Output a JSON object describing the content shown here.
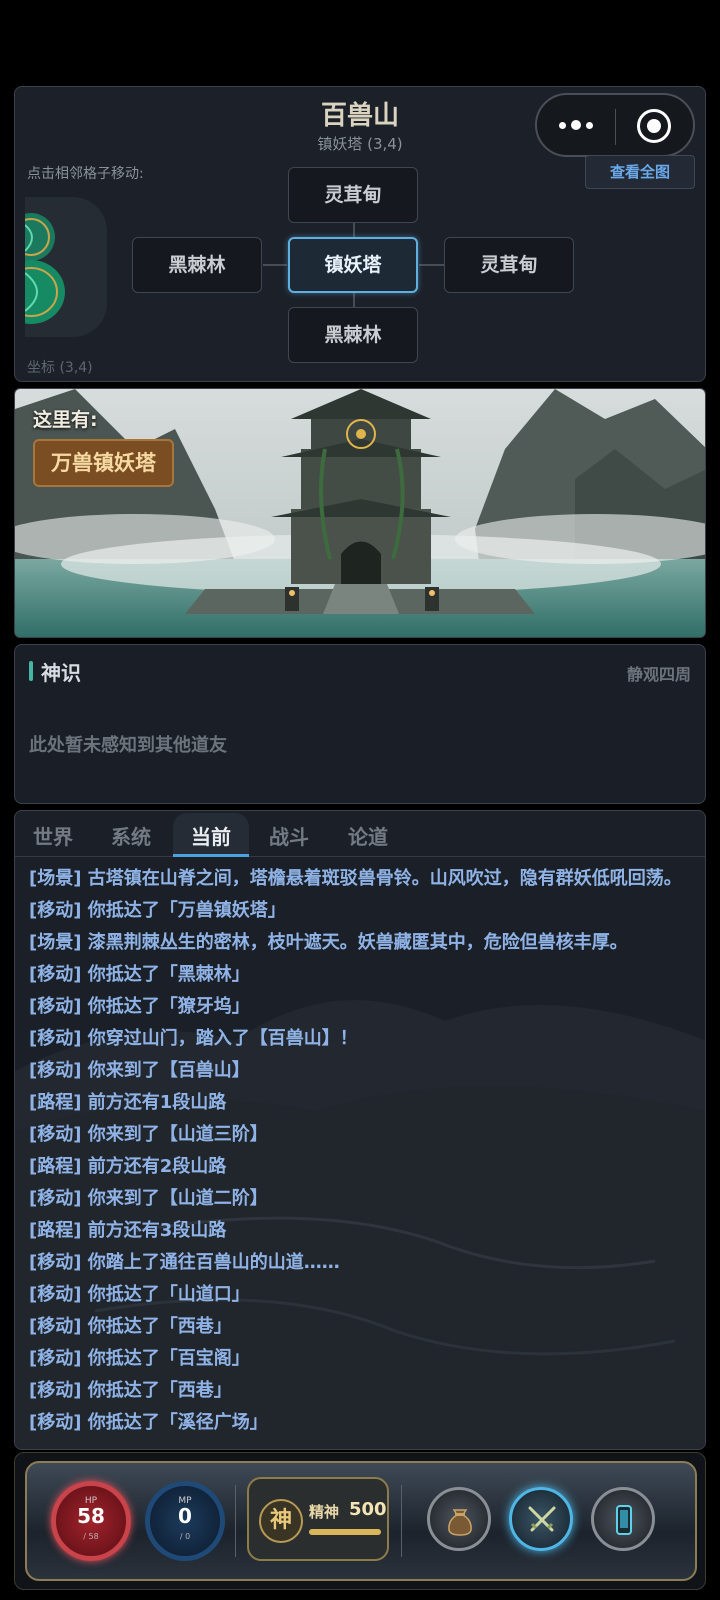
{
  "capsule": {
    "more_icon": "more-dots-icon",
    "close_icon": "record-target-icon"
  },
  "map": {
    "title": "百兽山",
    "subtitle": "镇妖塔 (3,4)",
    "hint": "点击相邻格子移动:",
    "coord": "坐标 (3,4)",
    "view_all": "查看全图",
    "cells": {
      "north": "灵茸甸",
      "west": "黑棘林",
      "center": "镇妖塔",
      "east": "灵茸甸",
      "south": "黑棘林"
    }
  },
  "scene": {
    "label": "这里有:",
    "poi": "万兽镇妖塔"
  },
  "sense": {
    "title": "神识",
    "action": "静观四周",
    "empty": "此处暂未感知到其他道友"
  },
  "tabs": [
    "世界",
    "系统",
    "当前",
    "战斗",
    "论道"
  ],
  "active_tab": "当前",
  "log": [
    "[场景] 古塔镇在山脊之间，塔檐悬着斑驳兽骨铃。山风吹过，隐有群妖低吼回荡。",
    "[移动] 你抵达了「万兽镇妖塔」",
    "[场景] 漆黑荆棘丛生的密林，枝叶遮天。妖兽藏匿其中，危险但兽核丰厚。",
    "[移动] 你抵达了「黑棘林」",
    "[移动] 你抵达了「獠牙坞」",
    "[移动] 你穿过山门，踏入了【百兽山】！",
    "[移动] 你来到了【百兽山】",
    "[路程] 前方还有1段山路",
    "[移动] 你来到了【山道三阶】",
    "[路程] 前方还有2段山路",
    "[移动] 你来到了【山道二阶】",
    "[路程] 前方还有3段山路",
    "[移动] 你踏上了通往百兽山的山道……",
    "[移动] 你抵达了「山道口」",
    "[移动] 你抵达了「西巷」",
    "[移动] 你抵达了「百宝阁」",
    "[移动] 你抵达了「西巷」",
    "[移动] 你抵达了「溪径广场」"
  ],
  "hud": {
    "hp": {
      "label": "HP",
      "value": "58",
      "max": "/ 58"
    },
    "mp": {
      "label": "MP",
      "value": "0",
      "max": "/ 0"
    },
    "spirit": {
      "badge": "神",
      "name": "精神",
      "value": "500",
      "fraction": 1.0
    },
    "buttons": [
      "bag-icon",
      "crossed-swords-icon",
      "phone-icon"
    ]
  },
  "colors": {
    "accent": "#5fb0e0",
    "poi": "#7a4d22",
    "log_text": "#8fb3e6",
    "hp": "#c8434a"
  }
}
